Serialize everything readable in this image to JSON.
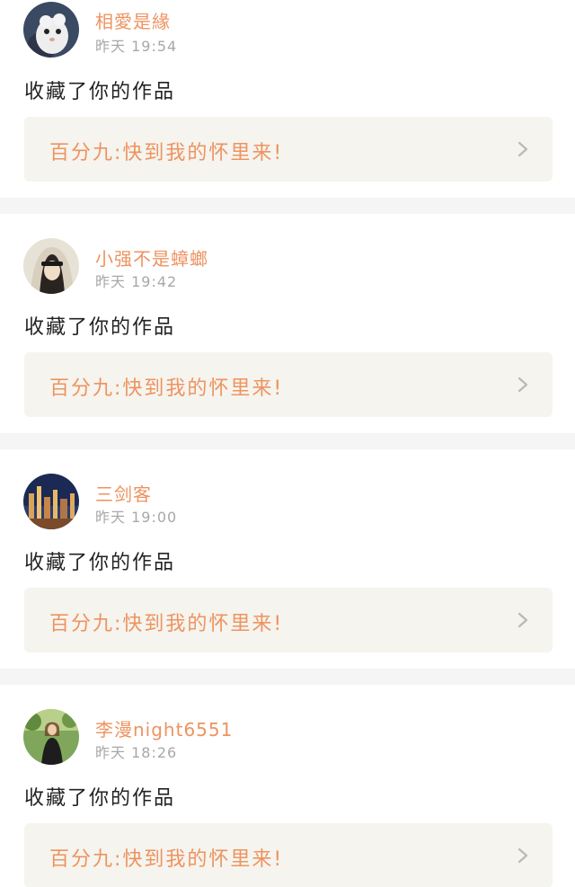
{
  "feed": [
    {
      "avatar": "cat-avatar",
      "username": "相愛是緣",
      "time": "昨天 19:54",
      "action": "收藏了你的作品",
      "work_title": "百分九:快到我的怀里来!"
    },
    {
      "avatar": "veiled-woman-avatar",
      "username": "小强不是蟑螂",
      "time": "昨天 19:42",
      "action": "收藏了你的作品",
      "work_title": "百分九:快到我的怀里来!"
    },
    {
      "avatar": "night-city-avatar",
      "username": "三剑客",
      "time": "昨天 19:00",
      "action": "收藏了你的作品",
      "work_title": "百分九:快到我的怀里来!"
    },
    {
      "avatar": "woman-outdoors-avatar",
      "username": "李漫night6551",
      "time": "昨天 18:26",
      "action": "收藏了你的作品",
      "work_title": "百分九:快到我的怀里来!"
    }
  ],
  "colors": {
    "accent": "#ee9360",
    "time_gray": "#a8a8a8",
    "text_dark": "#222222",
    "card_bg": "#f5f4ee",
    "divider": "#f5f5f5"
  },
  "icons": {
    "card_arrow": "chevron-right-icon"
  }
}
